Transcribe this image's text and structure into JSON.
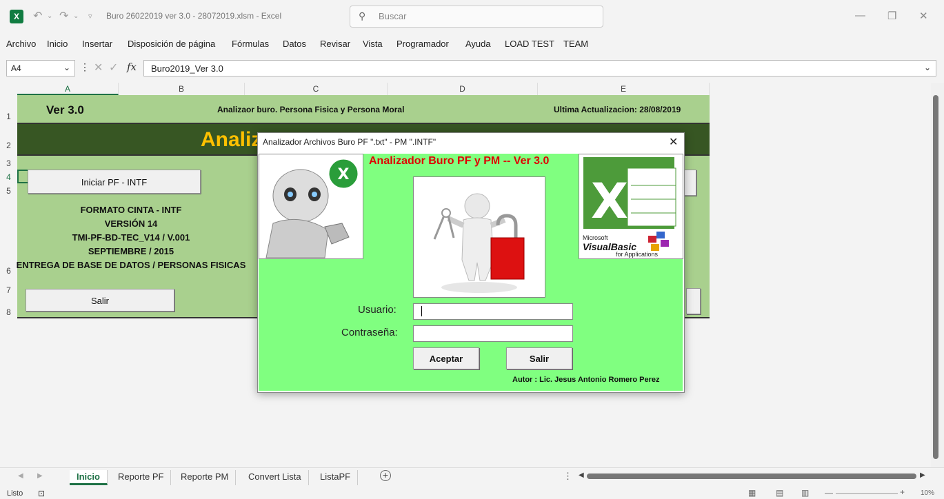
{
  "titlebar": {
    "app_icon": "excel-icon",
    "doc_title": "Buro 26022019 ver 3.0 - 28072019.xlsm  -  Excel",
    "search_placeholder": "Buscar"
  },
  "ribbon": {
    "tabs": [
      "Archivo",
      "Inicio",
      "Insertar",
      "Disposición de página",
      "Fórmulas",
      "Datos",
      "Revisar",
      "Vista",
      "Programador",
      "Ayuda",
      "LOAD TEST",
      "TEAM"
    ]
  },
  "formula_bar": {
    "name_box": "A4",
    "value": "Buro2019_Ver 3.0",
    "fx_label": "fx"
  },
  "columns": [
    "A",
    "B",
    "C",
    "D",
    "E"
  ],
  "rows": [
    "1",
    "2",
    "3",
    "4",
    "5",
    "6",
    "7",
    "8"
  ],
  "sheet": {
    "version": "Ver 3.0",
    "subtitle": "Analizaor buro. Persona Fisica y Persona Moral",
    "updated": "Ultima Actualizacion: 28/08/2019",
    "big_title": "Analiz",
    "btn_iniciar": "Iniciar PF - INTF",
    "info_lines": [
      "FORMATO CINTA - INTF",
      "VERSIÓN 14",
      "TMI-PF-BD-TEC_V14 / V.001",
      "SEPTIEMBRE / 2015",
      "ENTREGA DE BASE DE DATOS / PERSONAS FISICAS"
    ],
    "btn_salir": "Salir"
  },
  "dialog": {
    "title": "Analizador Archivos Buro PF \".txt\" - PM \".INTF\"",
    "heading": "Analizador Buro PF y PM  -- Ver 3.0",
    "label_user": "Usuario:",
    "label_pass": "Contraseña:",
    "user_value": "",
    "pass_value": "",
    "btn_accept": "Aceptar",
    "btn_exit": "Salir",
    "author": "Autor : Lic. Jesus Antonio Romero Perez",
    "vba_logo_text": "Microsoft",
    "vba_logo_main": "VisualBasic",
    "vba_logo_sub": "for Applications"
  },
  "sheet_tabs": [
    "Inicio",
    "Reporte PF",
    "Reporte PM",
    "Convert Lista",
    "ListaPF"
  ],
  "status": {
    "ready": "Listo",
    "zoom": "10%"
  },
  "colors": {
    "excel_green": "#1e7145",
    "sheet_green": "#a9d08e",
    "band_dark": "#375623",
    "title_gold": "#ffc000",
    "dialog_bg": "#80ff80",
    "heading_red": "#e00000"
  }
}
